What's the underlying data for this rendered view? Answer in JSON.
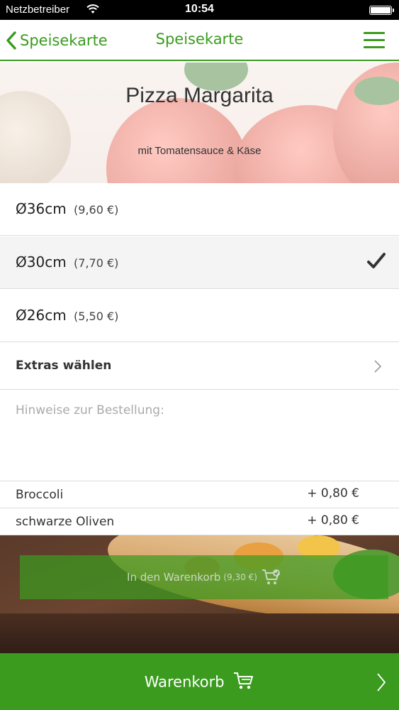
{
  "status_bar": {
    "carrier": "Netzbetreiber",
    "time": "10:54",
    "icons": [
      "wifi-icon",
      "battery-icon"
    ]
  },
  "nav": {
    "back_label": "Speisekarte",
    "title": "Speisekarte",
    "menu_icon": "hamburger-menu-icon",
    "accent_color": "#3a9b1e"
  },
  "product": {
    "name": "Pizza Margarita",
    "description": "mit Tomatensauce & Käse"
  },
  "sizes": [
    {
      "size": "Ø36cm",
      "price": "(9,60 €)",
      "selected": false
    },
    {
      "size": "Ø30cm",
      "price": "(7,70 €)",
      "selected": true
    },
    {
      "size": "Ø26cm",
      "price": "(5,50 €)",
      "selected": false
    }
  ],
  "extras": {
    "label": "Extras wählen",
    "chosen": [
      {
        "name": "Broccoli",
        "price": "+ 0,80 €"
      },
      {
        "name": "schwarze Oliven",
        "price": "+ 0,80 €"
      }
    ]
  },
  "notes": {
    "placeholder": "Hinweise zur Bestellung:",
    "value": ""
  },
  "add_to_cart": {
    "label": "In den Warenkorb",
    "price": "(9,30 €)"
  },
  "cart_bar": {
    "label": "Warenkorb"
  }
}
